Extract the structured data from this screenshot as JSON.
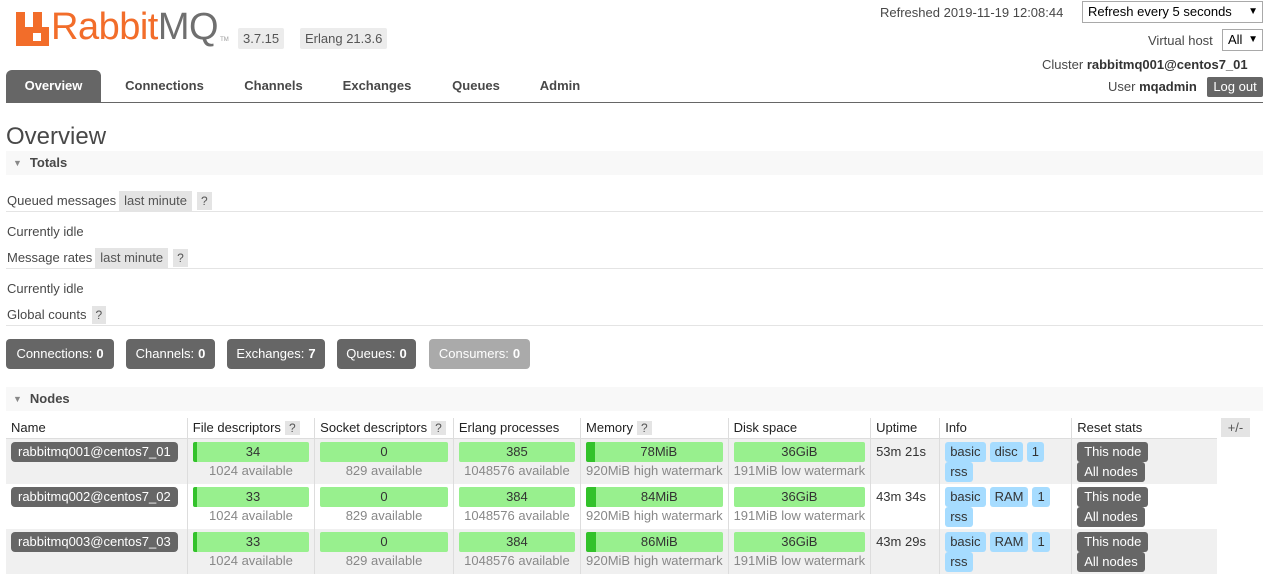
{
  "header": {
    "logo_brand": "Rabbit",
    "logo_brand2": "MQ",
    "logo_tm": "TM",
    "version": "3.7.15",
    "erlang": "Erlang 21.3.6",
    "refreshed": "Refreshed 2019-11-19 12:08:44",
    "refresh_select": "Refresh every 5 seconds",
    "vhost_label": "Virtual host",
    "vhost_select": "All",
    "cluster_label": "Cluster",
    "cluster_name": "rabbitmq001@centos7_01",
    "user_label": "User",
    "user_name": "mqadmin",
    "logout": "Log out"
  },
  "tabs": [
    "Overview",
    "Connections",
    "Channels",
    "Exchanges",
    "Queues",
    "Admin"
  ],
  "page_title": "Overview",
  "totals": {
    "title": "Totals",
    "queued_label": "Queued messages",
    "queued_range": "last minute",
    "help": "?",
    "idle1": "Currently idle",
    "rates_label": "Message rates",
    "rates_range": "last minute",
    "idle2": "Currently idle",
    "global_label": "Global counts"
  },
  "counts": [
    {
      "label": "Connections:",
      "value": "0"
    },
    {
      "label": "Channels:",
      "value": "0"
    },
    {
      "label": "Exchanges:",
      "value": "7"
    },
    {
      "label": "Queues:",
      "value": "0"
    },
    {
      "label": "Consumers:",
      "value": "0"
    }
  ],
  "nodes": {
    "title": "Nodes",
    "plusminus": "+/-",
    "columns": [
      "Name",
      "File descriptors",
      "Socket descriptors",
      "Erlang processes",
      "Memory",
      "Disk space",
      "Uptime",
      "Info",
      "Reset stats"
    ],
    "rows": [
      {
        "name": "rabbitmq001@centos7_01",
        "fd": "34",
        "fd_avail": "1024 available",
        "sd": "0",
        "sd_avail": "829 available",
        "ep": "385",
        "ep_avail": "1048576 available",
        "mem": "78MiB",
        "mem_wm": "920MiB high watermark",
        "disk": "36GiB",
        "disk_wm": "191MiB low watermark",
        "uptime": "53m 21s",
        "info": [
          "basic",
          "disc",
          "1",
          "rss"
        ],
        "reset": [
          "This node",
          "All nodes"
        ]
      },
      {
        "name": "rabbitmq002@centos7_02",
        "fd": "33",
        "fd_avail": "1024 available",
        "sd": "0",
        "sd_avail": "829 available",
        "ep": "384",
        "ep_avail": "1048576 available",
        "mem": "84MiB",
        "mem_wm": "920MiB high watermark",
        "disk": "36GiB",
        "disk_wm": "191MiB low watermark",
        "uptime": "43m 34s",
        "info": [
          "basic",
          "RAM",
          "1",
          "rss"
        ],
        "reset": [
          "This node",
          "All nodes"
        ]
      },
      {
        "name": "rabbitmq003@centos7_03",
        "fd": "33",
        "fd_avail": "1024 available",
        "sd": "0",
        "sd_avail": "829 available",
        "ep": "384",
        "ep_avail": "1048576 available",
        "mem": "86MiB",
        "mem_wm": "920MiB high watermark",
        "disk": "36GiB",
        "disk_wm": "191MiB low watermark",
        "uptime": "43m 29s",
        "info": [
          "basic",
          "RAM",
          "1",
          "rss"
        ],
        "reset": [
          "This node",
          "All nodes"
        ]
      }
    ]
  }
}
